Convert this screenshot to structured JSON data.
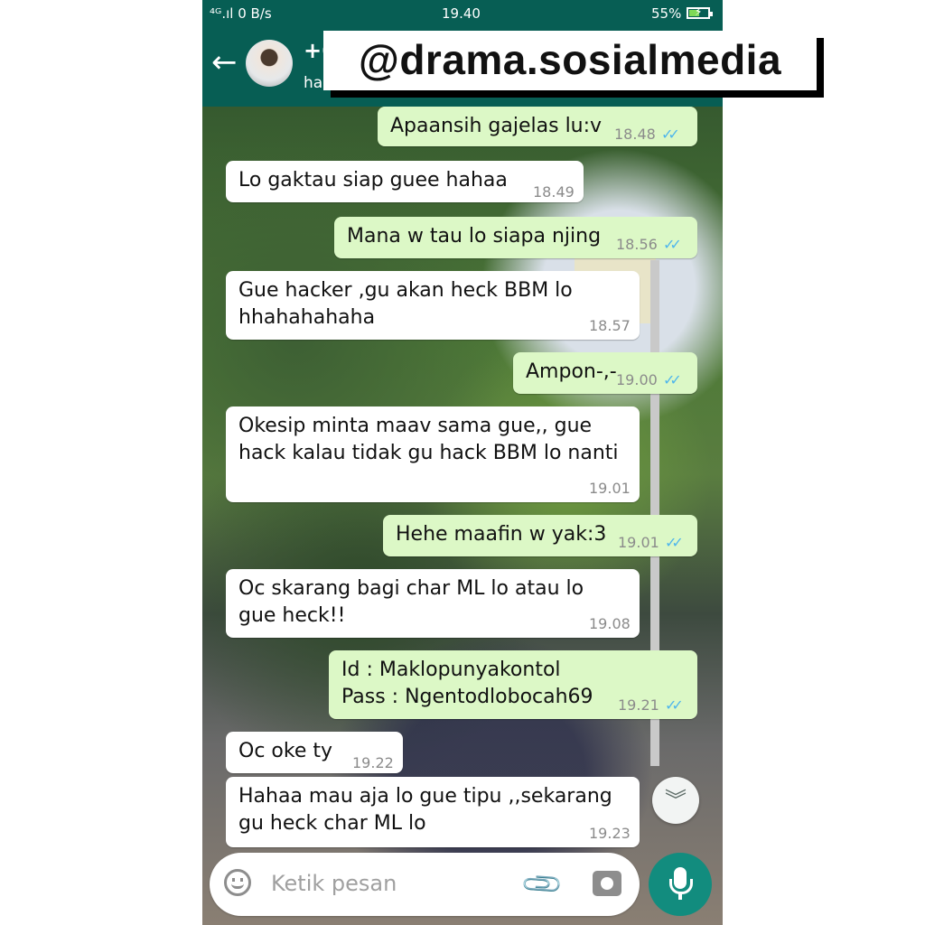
{
  "status_bar": {
    "network": "⁴ᴳ.ıl 0 B/s",
    "time": "19.40",
    "battery": "55%",
    "battery_level": 0.55
  },
  "header": {
    "back_icon": "arrow-left-icon",
    "contact_name": "+6",
    "contact_status": "ha"
  },
  "watermark": "@drama.sosialmedia",
  "messages": [
    {
      "dir": "out",
      "text": "Apaansih gajelas lu:v",
      "time": "18.48",
      "read": true
    },
    {
      "dir": "in",
      "text": "Lo gaktau siap guee hahaa",
      "time": "18.49"
    },
    {
      "dir": "out",
      "text": "Mana w tau lo siapa njing",
      "time": "18.56",
      "read": true
    },
    {
      "dir": "in",
      "text": "Gue hacker ,gu akan heck BBM lo\nhhahahahaha",
      "time": "18.57"
    },
    {
      "dir": "out",
      "text": "Ampon-,-",
      "time": "19.00",
      "read": true
    },
    {
      "dir": "in",
      "text": "Okesip minta maav sama gue,, gue\nhack kalau tidak gu hack BBM lo nanti",
      "time": "19.01"
    },
    {
      "dir": "out",
      "text": "Hehe maafin w yak:3",
      "time": "19.01",
      "read": true
    },
    {
      "dir": "in",
      "text": "Oc skarang bagi char ML lo atau lo\ngue heck!!",
      "time": "19.08"
    },
    {
      "dir": "out",
      "text": "Id : Maklopunyakontol\nPass : Ngentodlobocah69",
      "time": "19.21",
      "read": true
    },
    {
      "dir": "in",
      "text": "Oc oke ty",
      "time": "19.22"
    },
    {
      "dir": "in",
      "text": "Hahaa mau aja lo gue tipu ,,sekarang\ngu heck char ML lo",
      "time": "19.23"
    }
  ],
  "composer": {
    "placeholder": "Ketik pesan",
    "emoji_icon": "emoji-icon",
    "attach_icon": "paperclip-icon",
    "camera_icon": "camera-icon",
    "mic_icon": "mic-icon"
  },
  "scroll_down_icon": "double-chevron-down-icon",
  "colors": {
    "header": "#075e54",
    "outgoing_bubble": "#dcf8c6",
    "incoming_bubble": "#ffffff",
    "tick": "#4fb6ec",
    "mic_button": "#128c7e"
  }
}
